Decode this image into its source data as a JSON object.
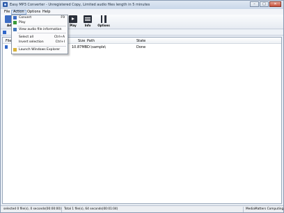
{
  "window": {
    "title": "Easy MP3 Converter - Unregistered Copy, Limited audio files length in 5 minutes",
    "minimize": "–",
    "maximize": "□",
    "close": "✕"
  },
  "menubar": {
    "items": [
      {
        "label": "File"
      },
      {
        "label": "Action"
      },
      {
        "label": "Options"
      },
      {
        "label": "Help"
      }
    ]
  },
  "toolbar": {
    "buttons": [
      {
        "label": "Ad",
        "icon": "add-icon"
      },
      {
        "label": "Play",
        "icon": "play-icon"
      },
      {
        "label": "Info",
        "icon": "info-icon"
      },
      {
        "label": "Options",
        "icon": "options-icon"
      }
    ]
  },
  "action_menu": {
    "items": [
      {
        "label": "Convert",
        "shortcut": "F9",
        "icon": "convert-icon"
      },
      {
        "label": "Play",
        "shortcut": "",
        "icon": "play-icon"
      },
      {
        "label": "View audio file information",
        "shortcut": "",
        "icon": "info-icon"
      },
      {
        "label": "Select all",
        "shortcut": "Ctrl+A",
        "icon": ""
      },
      {
        "label": "Invert selection",
        "shortcut": "Ctrl+I",
        "icon": ""
      },
      {
        "label": "Launch Windows Explorer",
        "shortcut": "",
        "icon": "explorer-icon"
      }
    ]
  },
  "file_list": {
    "columns": [
      "File",
      "Size",
      "Path",
      "State"
    ],
    "rows": [
      {
        "file": "",
        "size": "10.87MB",
        "path": "D:\\sample\\",
        "state": "Done"
      }
    ]
  },
  "statusbar": {
    "selected": "selected 0 file(s), 0 seconds(00:00:00)",
    "total": "Total 1 file(s), 64 seconds(00:01:04)",
    "vendor": "MediaMatters Computing"
  },
  "colors": {
    "accent": "#2f66c9",
    "menu_highlight": "#d8e4f4"
  }
}
